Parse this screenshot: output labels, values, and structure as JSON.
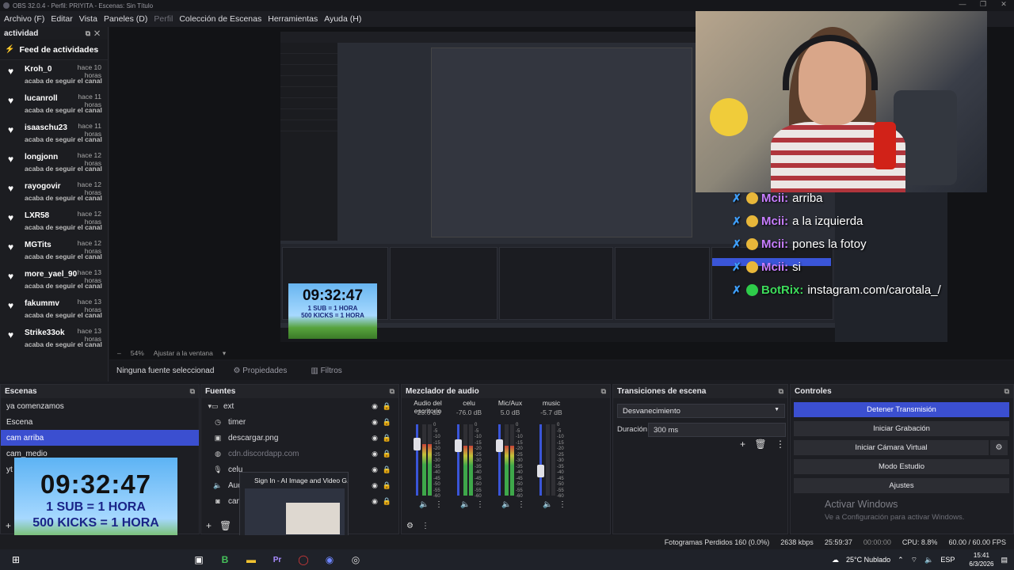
{
  "window": {
    "title": "OBS 32.0.4 - Perfil: PRIYITA - Escenas: Sin Título"
  },
  "menu": [
    "Archivo (F)",
    "Editar",
    "Vista",
    "Paneles (D)",
    "Perfil",
    "Colección de Escenas",
    "Herramientas",
    "Ayuda (H)"
  ],
  "activity": {
    "dock_title": "actividad",
    "feed_title": "Feed de actividades",
    "items": [
      {
        "user": "Kroh_0",
        "time": "hace 10 horas",
        "action": "acaba de seguir el canal"
      },
      {
        "user": "lucanroll",
        "time": "hace 11 horas",
        "action": "acaba de seguir el canal"
      },
      {
        "user": "isaaschu23",
        "time": "hace 11 horas",
        "action": "acaba de seguir el canal"
      },
      {
        "user": "longjonn",
        "time": "hace 12 horas",
        "action": "acaba de seguir el canal"
      },
      {
        "user": "rayogovir",
        "time": "hace 12 horas",
        "action": "acaba de seguir el canal"
      },
      {
        "user": "LXR58",
        "time": "hace 12 horas",
        "action": "acaba de seguir el canal"
      },
      {
        "user": "MGTits",
        "time": "hace 12 horas",
        "action": "acaba de seguir el canal"
      },
      {
        "user": "more_yael_90",
        "time": "hace 13 horas",
        "action": "acaba de seguir el canal"
      },
      {
        "user": "fakummv",
        "time": "hace 13 horas",
        "action": "acaba de seguir el canal"
      },
      {
        "user": "Strike33ok",
        "time": "hace 13 horas",
        "action": "acaba de seguir el canal"
      }
    ]
  },
  "chat": [
    {
      "name": "Mcii:",
      "msg": "arriba"
    },
    {
      "name": "Mcii:",
      "msg": "a la izquierda"
    },
    {
      "name": "Mcii:",
      "msg": "pones la fotoy"
    },
    {
      "name": "Mcii:",
      "msg": "si"
    },
    {
      "name": "BotRix:",
      "msg": "instagram.com/carotala_/"
    }
  ],
  "nested_timer": {
    "time": "09:32:47",
    "line1": "1 SUB = 1 HORA",
    "line2": "500 KICKS = 1 HORA"
  },
  "zoom": {
    "value": "54%",
    "fit": "Ajustar a la ventana"
  },
  "source_bar": {
    "none": "Ninguna fuente seleccionad",
    "properties": "Propiedades",
    "filters": "Filtros"
  },
  "scenes": {
    "title": "Escenas",
    "items": [
      "ya comenzamos",
      "Escena",
      "cam arriba",
      "cam_medio",
      "yt"
    ],
    "selected": 2
  },
  "sources": {
    "title": "Fuentes",
    "items": [
      {
        "name": "ext",
        "icon": "folder-icon"
      },
      {
        "name": "timer",
        "icon": "clock-icon"
      },
      {
        "name": "descargar.png",
        "icon": "image-icon"
      },
      {
        "name": "cdn.discordapp.com",
        "icon": "globe-icon"
      },
      {
        "name": "celu",
        "icon": "mic-icon"
      },
      {
        "name": "Audio",
        "icon": "speaker-icon"
      },
      {
        "name": "camar",
        "icon": "camera-icon"
      }
    ]
  },
  "mixer": {
    "title": "Mezclador de audio",
    "channels": [
      {
        "name": "Audio del escritorio",
        "db": "-23.6 dB",
        "level": 0.72
      },
      {
        "name": "celu",
        "db": "-76.0 dB",
        "level": 0.7
      },
      {
        "name": "Mic/Aux",
        "db": "5.0 dB",
        "level": 0.7
      },
      {
        "name": "music",
        "db": "-5.7 dB",
        "level": 0.0
      }
    ],
    "scale": [
      "0",
      "-5",
      "-10",
      "-15",
      "-20",
      "-25",
      "-30",
      "-35",
      "-40",
      "-45",
      "-50",
      "-55",
      "-60"
    ]
  },
  "transitions": {
    "title": "Transiciones de escena",
    "selected": "Desvanecimiento",
    "duration_label": "Duración",
    "duration": "300 ms"
  },
  "controls": {
    "title": "Controles",
    "buttons": [
      "Detener Transmisión",
      "Iniciar Grabación",
      "Iniciar Cámara Virtual",
      "Modo Estudio",
      "Ajustes"
    ]
  },
  "activate": {
    "title": "Activar Windows",
    "subtitle": "Ve a Configuración para activar Windows."
  },
  "timer_widget": {
    "time": "09:32:47",
    "line1": "1 SUB = 1 HORA",
    "line2": "500 KICKS = 1 HORA"
  },
  "tooltip": {
    "title": "Sign In - AI Image and Video G..."
  },
  "status": {
    "dropped": "Fotogramas Perdidos 160 (0.0%)",
    "bitrate": "2638 kbps",
    "stream_time": "25:59:37",
    "rec_time": "00:00:00",
    "cpu": "CPU: 8.8%",
    "fps": "60.00 / 60.00 FPS"
  },
  "tray": {
    "weather": "25°C Nublado",
    "lang": "ESP",
    "time": "15:41",
    "date": "6/3/2026"
  },
  "colors": {
    "accent": "#3b4fd0",
    "panel": "#1d1e23",
    "background": "#1a1b20"
  }
}
